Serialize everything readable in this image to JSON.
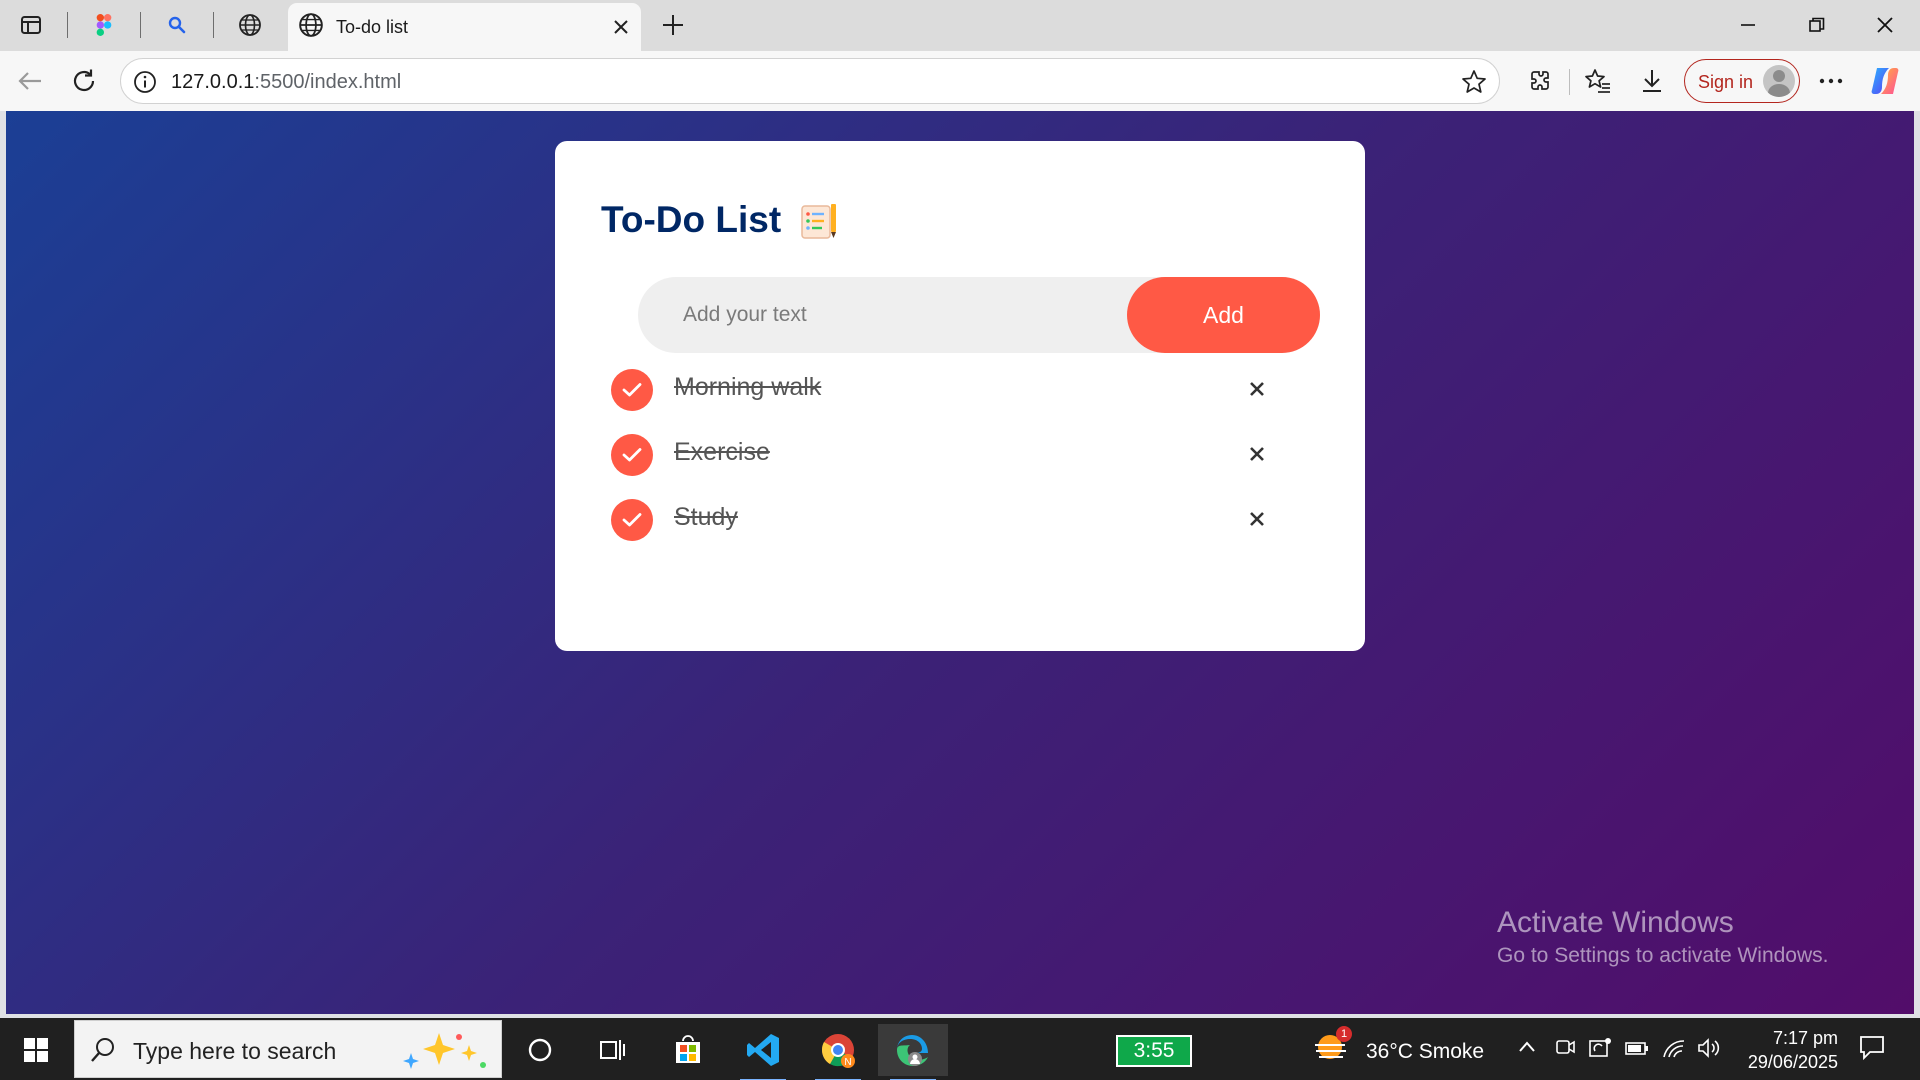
{
  "browser": {
    "active_tab_title": "To-do list",
    "url_host": "127.0.0.1",
    "url_path": ":5500/index.html",
    "signin_label": "Sign in"
  },
  "app": {
    "title": "To-Do List",
    "input_placeholder": "Add your text",
    "add_label": "Add",
    "accent_color": "#ff5945",
    "title_color": "#002765",
    "tasks": [
      {
        "text": "Morning walk",
        "checked": true
      },
      {
        "text": "Exercise",
        "checked": true
      },
      {
        "text": "Study",
        "checked": true
      }
    ]
  },
  "watermark": {
    "line1": "Activate Windows",
    "line2": "Go to Settings to activate Windows."
  },
  "taskbar": {
    "search_placeholder": "Type here to search",
    "battery_widget": "3:55",
    "weather_badge": "1",
    "weather_text": "36°C  Smoke",
    "time": "7:17 pm",
    "date": "29/06/2025"
  }
}
